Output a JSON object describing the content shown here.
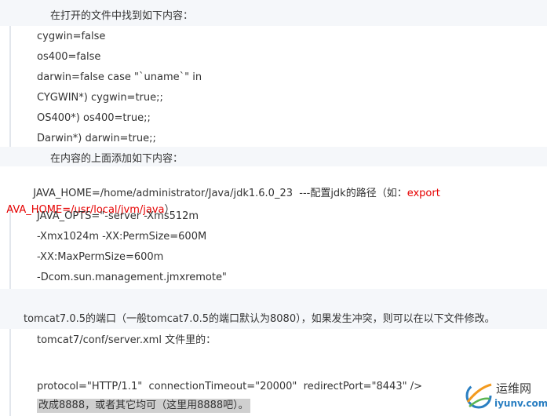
{
  "heading1": "在打开的文件中找到如下内容：",
  "block1": [
    "cygwin=false",
    "os400=false",
    "darwin=false case \"`uname`\" in",
    "CYGWIN*) cygwin=true;;",
    "OS400*) os400=true;;",
    "Darwin*) darwin=true;;"
  ],
  "heading2": "在内容的上面添加如下内容：",
  "java_home": {
    "prefix": "JAVA_HOME=/home/administrator/Java/jdk1.6.0_23  ---配置jdk的路径（如：",
    "example_start": "export",
    "example_rest": "AVA_HOME=/usr/local/jvm/java",
    "suffix": "）"
  },
  "block2": [
    "JAVA_OPTS=\"-server -Xms512m",
    "-Xmx1024m -XX:PermSize=600M",
    "-XX:MaxPermSize=600m",
    "-Dcom.sun.management.jmxremote\""
  ],
  "port_note": "tomcat7.0.5的端口（一般tomcat7.0.5的端口默认为8080），如果发生冲突，则可以在以下文件修改。",
  "block3": {
    "file_line": "tomcat7/conf/server.xml 文件里的：",
    "protocol_line": "protocol=\"HTTP/1.1\"  connectionTimeout=\"20000\"  redirectPort=\"8443\" />",
    "change_line": "改成8888，或者其它均可（这里用8888吧）。"
  },
  "watermark": {
    "cn": "运维网",
    "en": "iyunv.com"
  },
  "colors": {
    "shade": "#f5f7fa",
    "accent_red": "#e60000",
    "highlight": "#cfcfcf",
    "logo_blue": "#2a7fc2"
  }
}
